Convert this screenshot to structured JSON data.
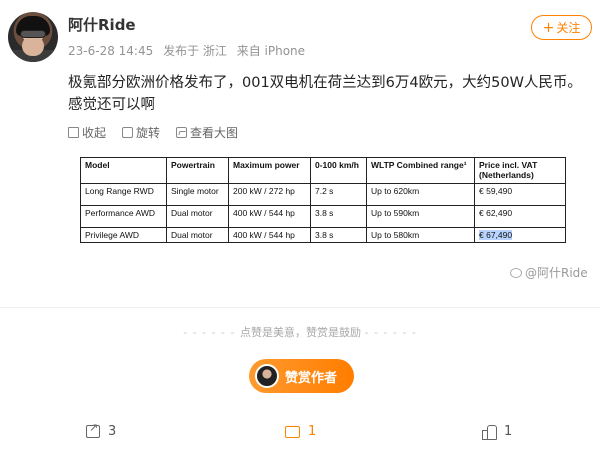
{
  "post": {
    "username": "阿什Ride",
    "date": "23-6-28 14:45",
    "published_from": "发布于 浙江",
    "device": "来自 iPhone",
    "follow_label": "关注",
    "text": "极氪部分欧洲价格发布了，001双电机在荷兰达到6万4欧元，大约50W人民币。感觉还可以啊"
  },
  "post_actions": {
    "collect": "收起",
    "rotate": "旋转",
    "view_large": "查看大图"
  },
  "price_table": {
    "headers": [
      "Model",
      "Powertrain",
      "Maximum power",
      "0-100 km/h",
      "WLTP Combined range¹",
      "Price incl. VAT (Netherlands)"
    ],
    "rows": [
      [
        "Long Range RWD",
        "Single motor",
        "200 kW / 272 hp",
        "7.2 s",
        "Up to 620km",
        "€ 59,490"
      ],
      [
        "Performance AWD",
        "Dual motor",
        "400 kW / 544 hp",
        "3.8 s",
        "Up to 590km",
        "€ 62,490"
      ],
      [
        "Privilege AWD",
        "Dual motor",
        "400 kW / 544 hp",
        "3.8 s",
        "Up to 580km",
        "€ 67,490"
      ]
    ]
  },
  "watermark": "@阿什Ride",
  "praise_hint": "点赞是美意，赞赏是鼓励",
  "reward_label": "赞赏作者",
  "bottom_bar": {
    "share_count": "3",
    "comment_count": "1",
    "like_count": "1"
  },
  "colors": {
    "accent": "#ff8200",
    "highlight": "#b8d3ff"
  },
  "icons": [
    "bookmark-icon",
    "rotate-icon",
    "view-image-icon",
    "share-icon",
    "comment-icon",
    "like-icon"
  ]
}
